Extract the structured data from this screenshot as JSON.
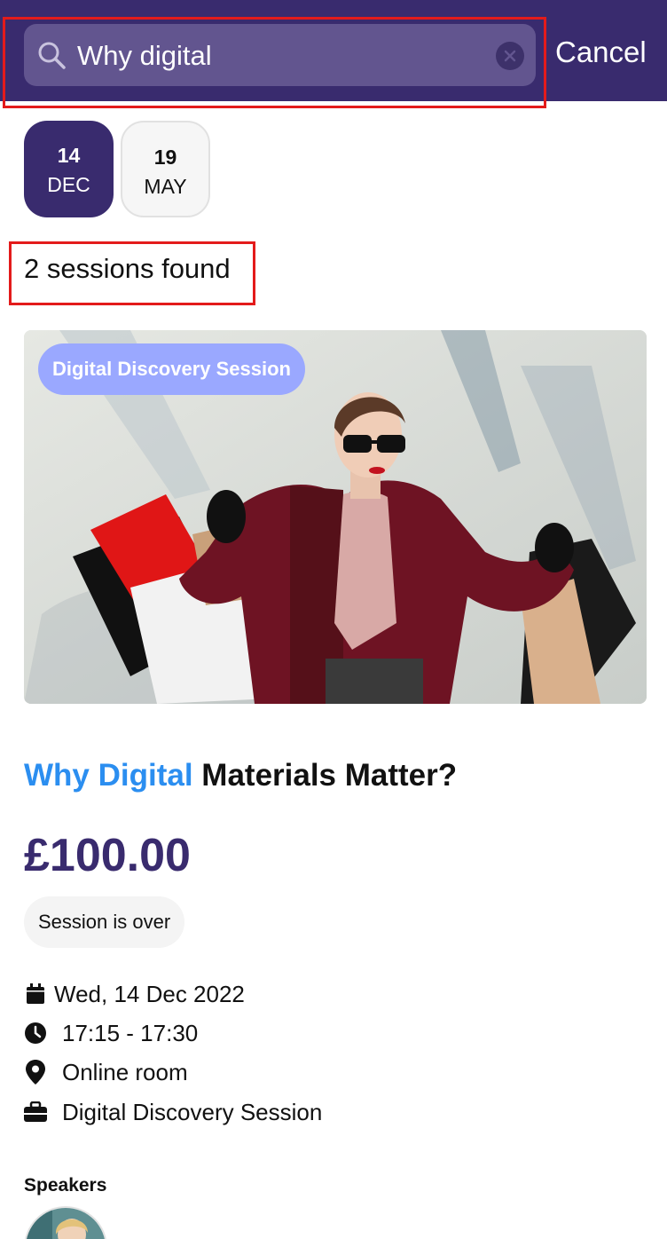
{
  "search": {
    "value": "Why digital",
    "cancel_label": "Cancel"
  },
  "dates": [
    {
      "day": "14",
      "month": "DEC",
      "selected": true
    },
    {
      "day": "19",
      "month": "MAY",
      "selected": false
    }
  ],
  "results": {
    "count_text": "2 sessions found"
  },
  "session": {
    "tag": "Digital Discovery Session",
    "title_highlight": "Why Digital",
    "title_rest": " Materials Matter?",
    "price": "£100.00",
    "status": "Session is over",
    "date": "Wed, 14 Dec 2022",
    "time": "17:15 - 17:30",
    "location": "Online room",
    "track": "Digital Discovery Session",
    "speakers_label": "Speakers"
  },
  "colors": {
    "header_bg": "#392b6e",
    "search_bg": "#62558f",
    "highlight": "#2b8ef0",
    "tag_bg": "#9aa8ff",
    "annotation": "#e31b1b"
  },
  "icons": [
    "search-icon",
    "clear-icon",
    "calendar-icon",
    "clock-icon",
    "location-pin-icon",
    "briefcase-icon"
  ]
}
